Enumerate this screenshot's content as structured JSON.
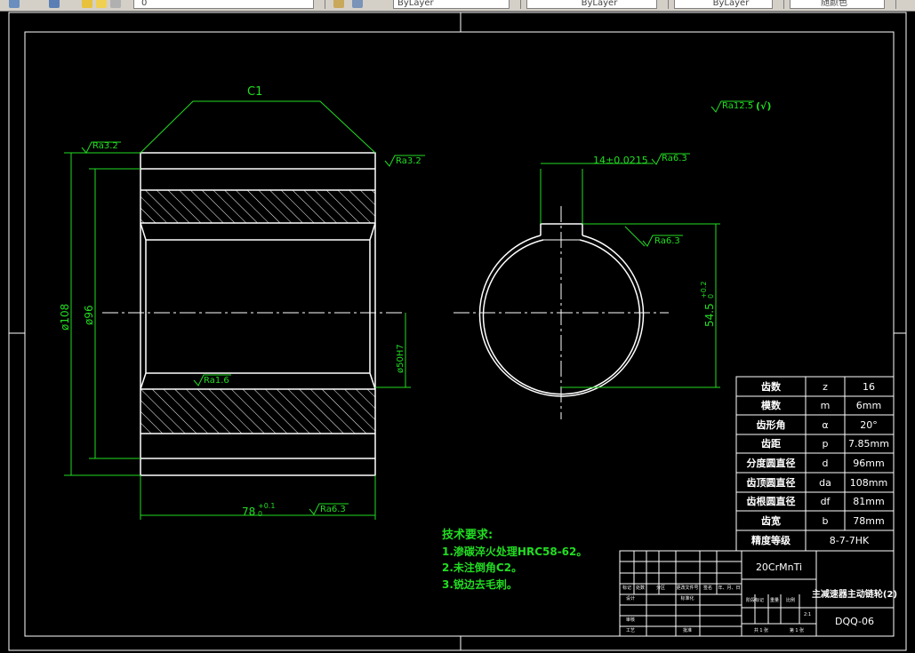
{
  "toolbar": {
    "layer_value": "0",
    "color_control": "ByLayer",
    "linetype_control": "ByLayer",
    "lineweight_control": "ByLayer",
    "plotstyle_control": "随颜色"
  },
  "drawing": {
    "chamfer_label": "C1",
    "rough_top_left": "Ra3.2",
    "rough_top_right": "Ra3.2",
    "rough_inner": "Ra1.6",
    "rough_bottom": "Ra6.3",
    "rough_general": "Ra12.5",
    "rough_general_suffix": "(√)",
    "dim_outer": "ø108",
    "dim_inner": "ø96",
    "dim_bore": "ø50H7",
    "dim_length": "78",
    "dim_length_tol": "+0.1",
    "dim_length_tol_low": "0",
    "keyway_width": "14±0.0215",
    "keyway_rough": "Ra6.3",
    "keyway_side_rough": "Ra6.3",
    "keyway_depth": "54.5",
    "keyway_depth_tol": "+0.2",
    "keyway_depth_tol_low": "0"
  },
  "params_table": [
    {
      "name": "齿数",
      "symbol": "z",
      "value": "16"
    },
    {
      "name": "模数",
      "symbol": "m",
      "value": "6mm"
    },
    {
      "name": "齿形角",
      "symbol": "α",
      "value": "20°"
    },
    {
      "name": "齿距",
      "symbol": "p",
      "value": "7.85mm"
    },
    {
      "name": "分度圆直径",
      "symbol": "d",
      "value": "96mm"
    },
    {
      "name": "齿顶圆直径",
      "symbol": "da",
      "value": "108mm"
    },
    {
      "name": "齿根圆直径",
      "symbol": "df",
      "value": "81mm"
    },
    {
      "name": "齿宽",
      "symbol": "b",
      "value": "78mm"
    }
  ],
  "params_footer": {
    "name": "精度等级",
    "value": "8-7-7HK"
  },
  "tech_requirements": {
    "title": "技术要求:",
    "items": [
      "1.渗碳淬火处理HRC58-62。",
      "2.未注倒角C2。",
      "3.锐边去毛刺。"
    ]
  },
  "title_block": {
    "material": "20CrMnTi",
    "part_name": "主减速器主动链轮(2)",
    "drawing_no": "DQQ-06",
    "hdr_labels": [
      "标记",
      "处数",
      "分区",
      "更改文件号",
      "签名",
      "年、月、日"
    ],
    "design_label": "设计",
    "standard_label": "标准化",
    "stage_label": "阶段标记",
    "weight_label": "重量",
    "scale_label": "比例",
    "scale_value": "2:1",
    "review_label": "审核",
    "process_label": "工艺",
    "approve_label": "批准",
    "sheets_total": "共 1 张",
    "sheet_no": "第 1 张"
  }
}
